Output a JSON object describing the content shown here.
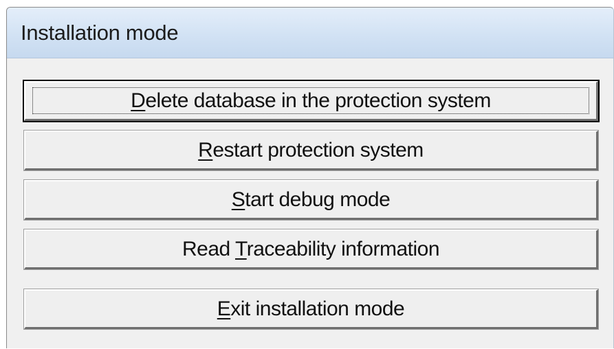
{
  "window": {
    "title": "Installation mode"
  },
  "buttons": [
    {
      "pre": "",
      "mnemonic": "D",
      "post": "elete database in the protection system",
      "default": true
    },
    {
      "pre": "",
      "mnemonic": "R",
      "post": "estart protection system",
      "default": false
    },
    {
      "pre": "",
      "mnemonic": "S",
      "post": "tart debug mode",
      "default": false
    },
    {
      "pre": "Read ",
      "mnemonic": "T",
      "post": "raceability information",
      "default": false
    },
    {
      "pre": "",
      "mnemonic": "E",
      "post": "xit installation mode",
      "default": false
    }
  ]
}
